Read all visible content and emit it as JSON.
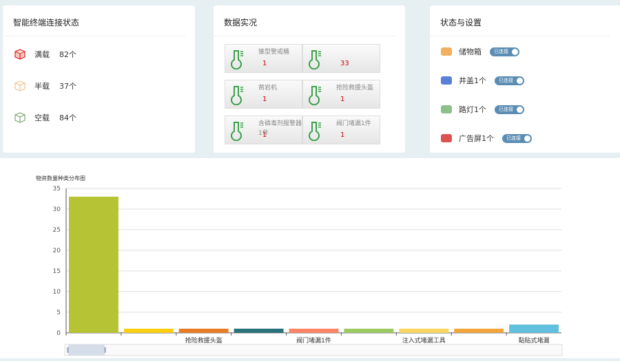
{
  "terminal": {
    "title": "智能终端连接状态",
    "items": [
      {
        "label": "满载",
        "count": "82个",
        "color": "#e0201a"
      },
      {
        "label": "半载",
        "count": "37个",
        "color": "#f5c08a"
      },
      {
        "label": "空载",
        "count": "84个",
        "color": "#7aa86a"
      }
    ]
  },
  "realtime": {
    "title": "数据实况",
    "tiles": [
      {
        "name": "锥型警戒桶",
        "value": "1"
      },
      {
        "name": "",
        "value": "33"
      },
      {
        "name": "凿岩机",
        "value": "1"
      },
      {
        "name": "抢险救援头盔",
        "value": "1"
      },
      {
        "name": "含磷毒剂报警器1件",
        "value": "1"
      },
      {
        "name": "阀门堵漏1件",
        "value": "1"
      }
    ]
  },
  "settings": {
    "title": "状态与设置",
    "items": [
      {
        "label": "储物箱",
        "status": "已连接",
        "color": "#f0b060"
      },
      {
        "label": "井盖1个",
        "status": "已连接",
        "color": "#5b7fd6"
      },
      {
        "label": "路灯1个",
        "status": "已连接",
        "color": "#8cc08c"
      },
      {
        "label": "广告屏1个",
        "status": "已连接",
        "color": "#d9534f"
      }
    ]
  },
  "chart_data": {
    "type": "bar",
    "title": "物资数量种类分布图",
    "categories": [
      "",
      "",
      "抢险救援头盔",
      "",
      "阀门堵漏1件",
      "",
      "注入式堵漏工具",
      "",
      "黏贴式堵漏"
    ],
    "values": [
      33,
      1,
      1,
      1,
      1,
      1,
      1,
      1,
      2
    ],
    "colors": [
      "#b5c334",
      "#fcce10",
      "#e87c25",
      "#27727b",
      "#fe8463",
      "#9bca63",
      "#fad860",
      "#f3a43b",
      "#60c0dd"
    ],
    "ylim": [
      0,
      35
    ],
    "yticks": [
      0,
      5,
      10,
      15,
      20,
      25,
      30,
      35
    ],
    "grid": true
  }
}
